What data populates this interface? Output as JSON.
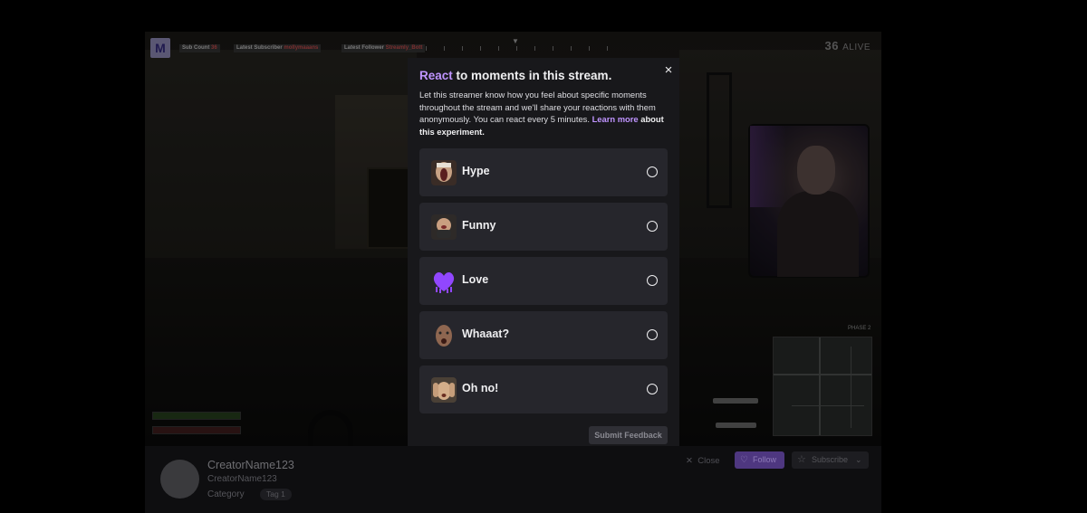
{
  "hud": {
    "logo_letter": "M",
    "sub_count_label": "Sub Count",
    "sub_count_value": "36",
    "latest_subscriber_label": "Latest Subscriber",
    "latest_subscriber_value": "mollymaaans",
    "latest_follower_label": "Latest Follower",
    "latest_follower_value": "Streamly_Bott",
    "alive_count": "36",
    "alive_label": "ALIVE",
    "phase_label": "PHASE 2"
  },
  "modal": {
    "title_accent": "React",
    "title_rest": " to moments in this stream.",
    "description": "Let this streamer know how you feel about specific moments throughout the stream and we'll share your reactions with them anonymously. You can react every 5 minutes. ",
    "learn_more": "Learn more",
    "about_experiment": " about this experiment.",
    "close_icon": "×",
    "options": [
      {
        "label": "Hype",
        "emote": "hype-emote",
        "color": "#6b4a3a"
      },
      {
        "label": "Funny",
        "emote": "funny-emote",
        "color": "#8a6a55"
      },
      {
        "label": "Love",
        "emote": "love-emote",
        "color": "#9147ff"
      },
      {
        "label": "Whaaat?",
        "emote": "whaaat-emote",
        "color": "#7a5a4a"
      },
      {
        "label": "Oh no!",
        "emote": "oh-no-emote",
        "color": "#b08b6a"
      }
    ],
    "submit_label": "Submit Feedback"
  },
  "channel": {
    "creator_name": "CreatorName123",
    "creator_sub": "CreatorName123",
    "category": "Category",
    "tag": "Tag 1",
    "close_label": "Close",
    "follow_label": "Follow",
    "subscribe_label": "Subscribe"
  }
}
